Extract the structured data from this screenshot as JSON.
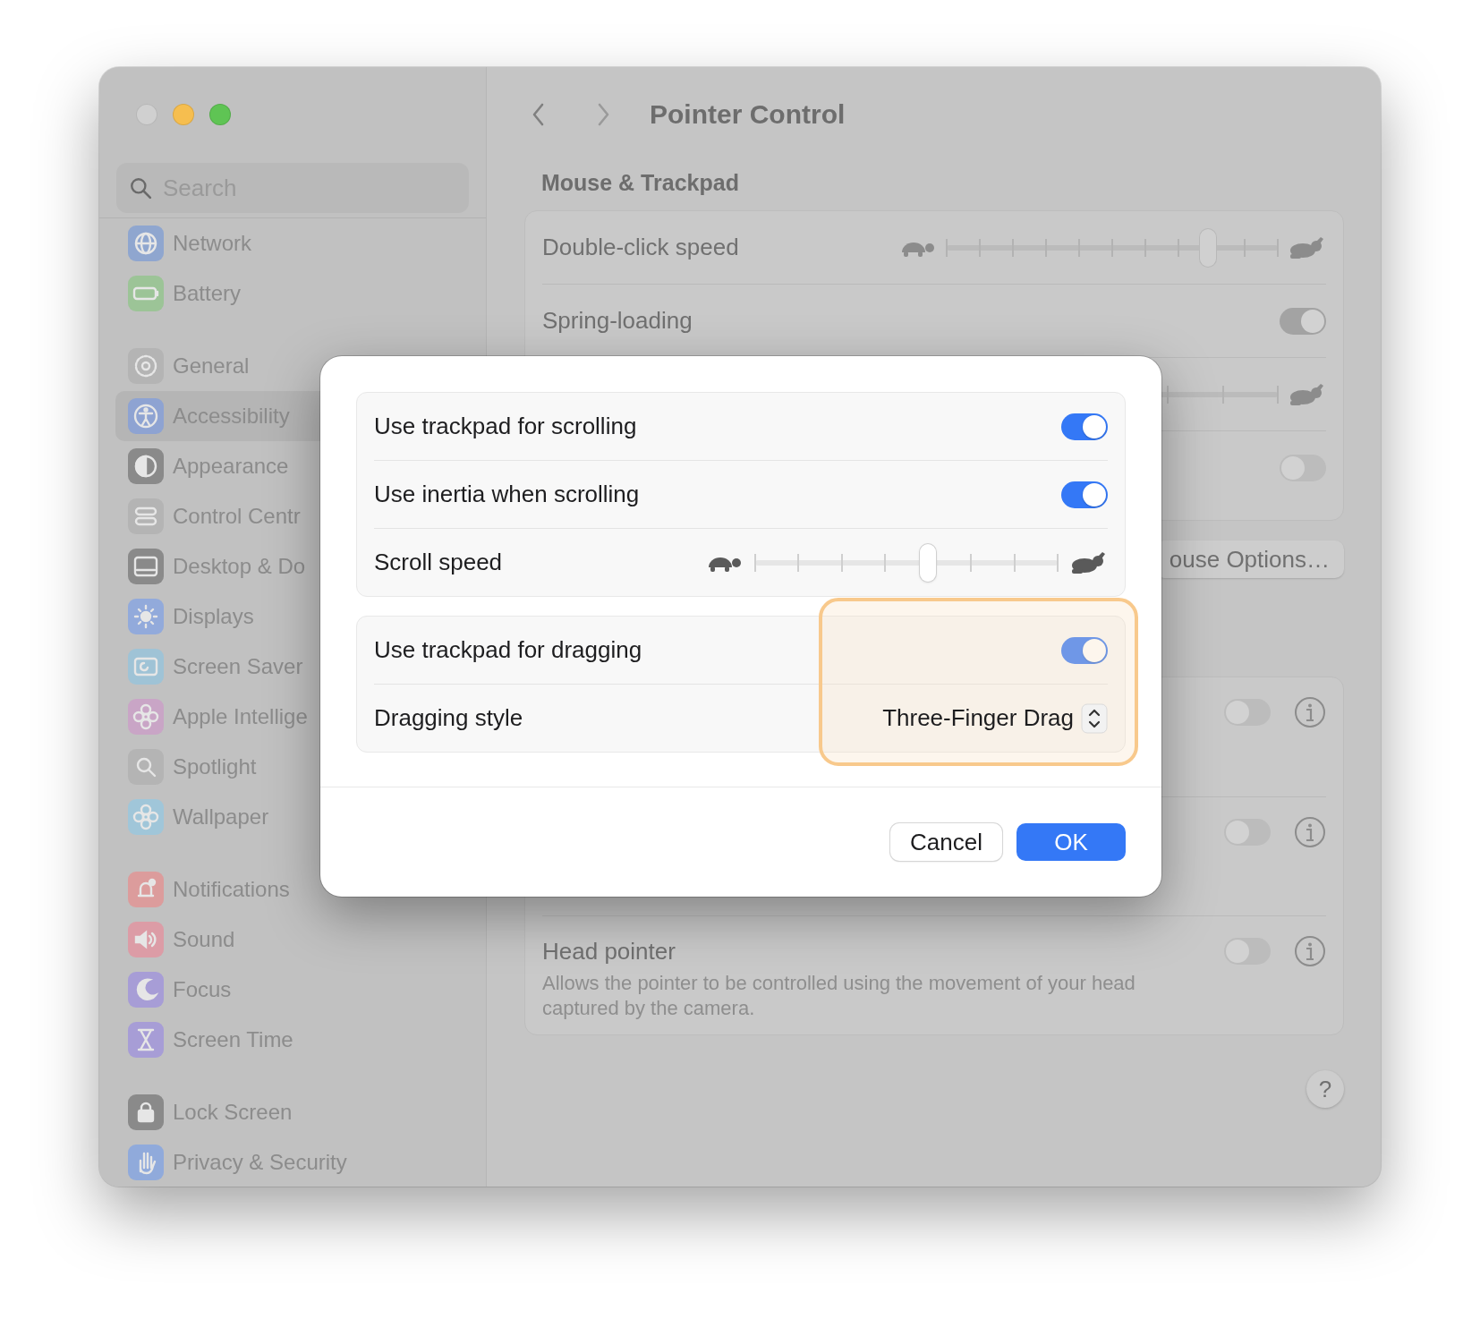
{
  "window": {
    "title": "Pointer Control",
    "traffic_lights": [
      {
        "kind": "close"
      },
      {
        "kind": "minimize"
      },
      {
        "kind": "zoom"
      }
    ]
  },
  "sidebar": {
    "search": {
      "placeholder": "Search"
    },
    "groups": [
      {
        "items": [
          {
            "label": "Network",
            "color": "#8fa6cf",
            "selected": false
          },
          {
            "label": "Battery",
            "color": "#9cc497",
            "selected": false
          }
        ]
      },
      {
        "items": [
          {
            "label": "General",
            "color": "#b4b4b4",
            "selected": false
          },
          {
            "label": "Accessibility",
            "color": "#8ea3d2",
            "selected": true
          },
          {
            "label": "Appearance",
            "color": "#8a8a8a",
            "selected": false
          },
          {
            "label": "Control Centr",
            "color": "#b4b4b4",
            "selected": false
          },
          {
            "label": "Desktop & Do",
            "color": "#8a8a8a",
            "selected": false
          },
          {
            "label": "Displays",
            "color": "#92aadb",
            "selected": false
          },
          {
            "label": "Screen Saver",
            "color": "#9fc3d6",
            "selected": false
          },
          {
            "label": "Apple Intellige",
            "color": "#c9a5c6",
            "selected": false
          },
          {
            "label": "Spotlight",
            "color": "#b4b4b4",
            "selected": false
          },
          {
            "label": "Wallpaper",
            "color": "#a0c6d9",
            "selected": false
          }
        ]
      },
      {
        "items": [
          {
            "label": "Notifications",
            "color": "#dc9c9c",
            "selected": false
          },
          {
            "label": "Sound",
            "color": "#dc9ca6",
            "selected": false
          },
          {
            "label": "Focus",
            "color": "#a79dd6",
            "selected": false
          },
          {
            "label": "Screen Time",
            "color": "#a79dd6",
            "selected": false
          }
        ]
      },
      {
        "items": [
          {
            "label": "Lock Screen",
            "color": "#8a8a8a",
            "selected": false
          },
          {
            "label": "Privacy & Security",
            "color": "#90aadb",
            "selected": false
          }
        ]
      }
    ]
  },
  "content": {
    "section_title": "Mouse & Trackpad",
    "mouse_card": [
      {
        "kind": "slider",
        "label": "Double-click speed",
        "level": 0.79
      },
      {
        "kind": "toggle",
        "label": "Spring-loading",
        "on": true
      },
      {
        "kind": "track"
      },
      {
        "kind": "toggle",
        "on": false
      }
    ],
    "mouse_options_button": "ouse Options…",
    "pointer_card": [
      {
        "on": false
      },
      {
        "on": false
      },
      {
        "label": "Head pointer",
        "description": "Allows the pointer to be controlled using the movement of your head captured by the camera.",
        "on": false
      }
    ],
    "help_button": "?"
  },
  "dialog": {
    "groups": [
      {
        "highlight": false,
        "rows": [
          {
            "kind": "toggle",
            "label": "Use trackpad for scrolling",
            "on": true
          },
          {
            "kind": "toggle",
            "label": "Use inertia when scrolling",
            "on": true
          },
          {
            "kind": "slider",
            "label": "Scroll speed",
            "level": 0.57
          }
        ]
      },
      {
        "highlight": true,
        "rows": [
          {
            "kind": "toggle",
            "label": "Use trackpad for dragging",
            "on": true
          },
          {
            "kind": "popup",
            "label": "Dragging style",
            "value": "Three-Finger Drag"
          }
        ]
      }
    ],
    "buttons": [
      {
        "label": "Cancel",
        "kind": "secondary"
      },
      {
        "label": "OK",
        "kind": "primary"
      }
    ]
  }
}
